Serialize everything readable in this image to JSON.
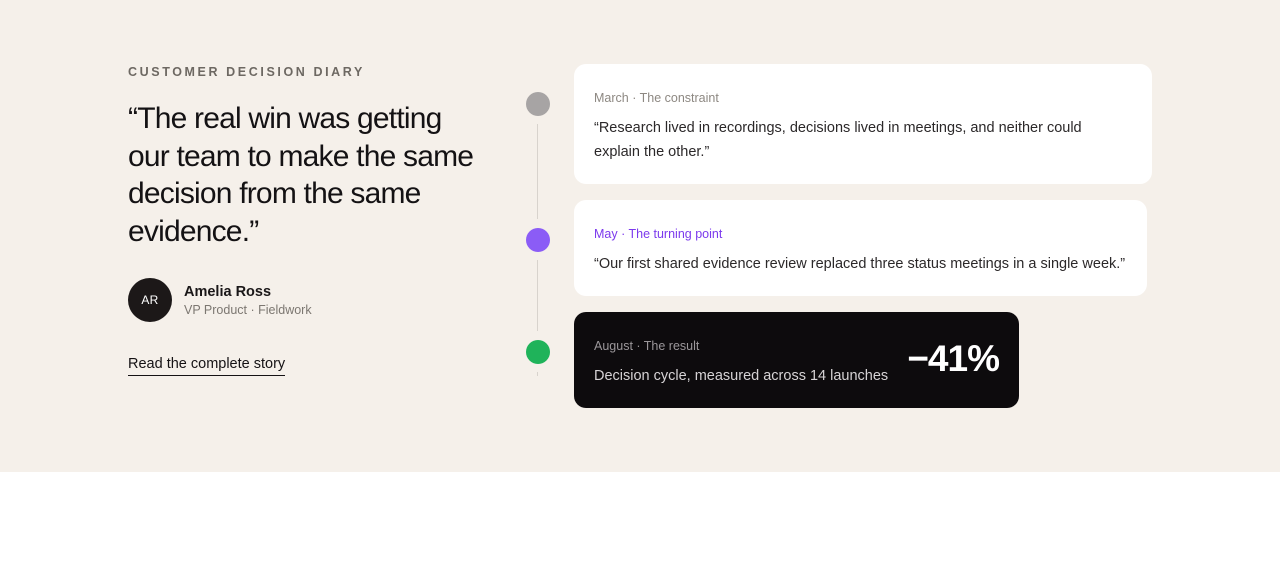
{
  "colors": {
    "section_bg": "#f5f0ea",
    "dot_constraint": "#a7a4a4",
    "dot_turning": "#8b5cf6",
    "dot_result": "#1fb35a",
    "accent_purple": "#7c3aed",
    "dark_card": "#0d0b0d"
  },
  "testimonial": {
    "eyebrow": "CUSTOMER DECISION DIARY",
    "quote": "“The real win was getting our team to make the same decision from the same evidence.”",
    "avatar_initials": "AR",
    "name": "Amelia Ross",
    "role": "VP Product · Fieldwork",
    "link_label": "Read the complete story"
  },
  "timeline": [
    {
      "label": "March · The constraint",
      "text": "“Research lived in recordings, decisions lived in meetings, and neither could explain the other.”",
      "dot_color": "#a7a4a4"
    },
    {
      "label": "May · The turning point",
      "text": "“Our first shared evidence review replaced three status meetings in a single week.”",
      "dot_color": "#8b5cf6"
    },
    {
      "label": "August · The result",
      "text": "Decision cycle, measured across 14 launches",
      "stat": "−41%",
      "dot_color": "#1fb35a"
    }
  ]
}
